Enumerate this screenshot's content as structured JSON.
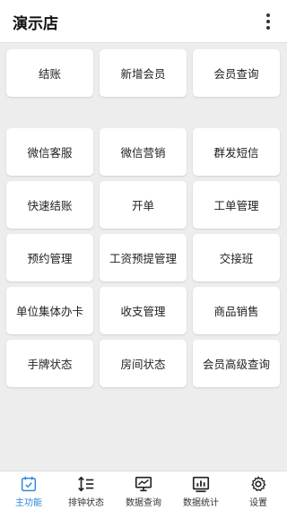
{
  "header": {
    "title": "演示店",
    "menu_icon": "more-vertical-icon"
  },
  "grid": {
    "row1": [
      "结账",
      "新增会员",
      "会员查询"
    ],
    "row2": [
      "微信客服",
      "微信营销",
      "群发短信"
    ],
    "row3": [
      "快速结账",
      "开单",
      "工单管理"
    ],
    "row4": [
      "预约管理",
      "工资预提管理",
      "交接班"
    ],
    "row5": [
      "单位集体办卡",
      "收支管理",
      "商品销售"
    ],
    "row6": [
      "手牌状态",
      "房间状态",
      "会员高级查询"
    ]
  },
  "bottom_nav": {
    "items": [
      {
        "label": "主功能",
        "icon": "calendar-check-icon",
        "active": true
      },
      {
        "label": "排钟状态",
        "icon": "sort-list-icon",
        "active": false
      },
      {
        "label": "数据查询",
        "icon": "monitor-chart-icon",
        "active": false
      },
      {
        "label": "数据统计",
        "icon": "bar-stats-icon",
        "active": false
      },
      {
        "label": "设置",
        "icon": "gear-icon",
        "active": false
      }
    ],
    "active_color": "#2e86de",
    "inactive_color": "#333333"
  }
}
